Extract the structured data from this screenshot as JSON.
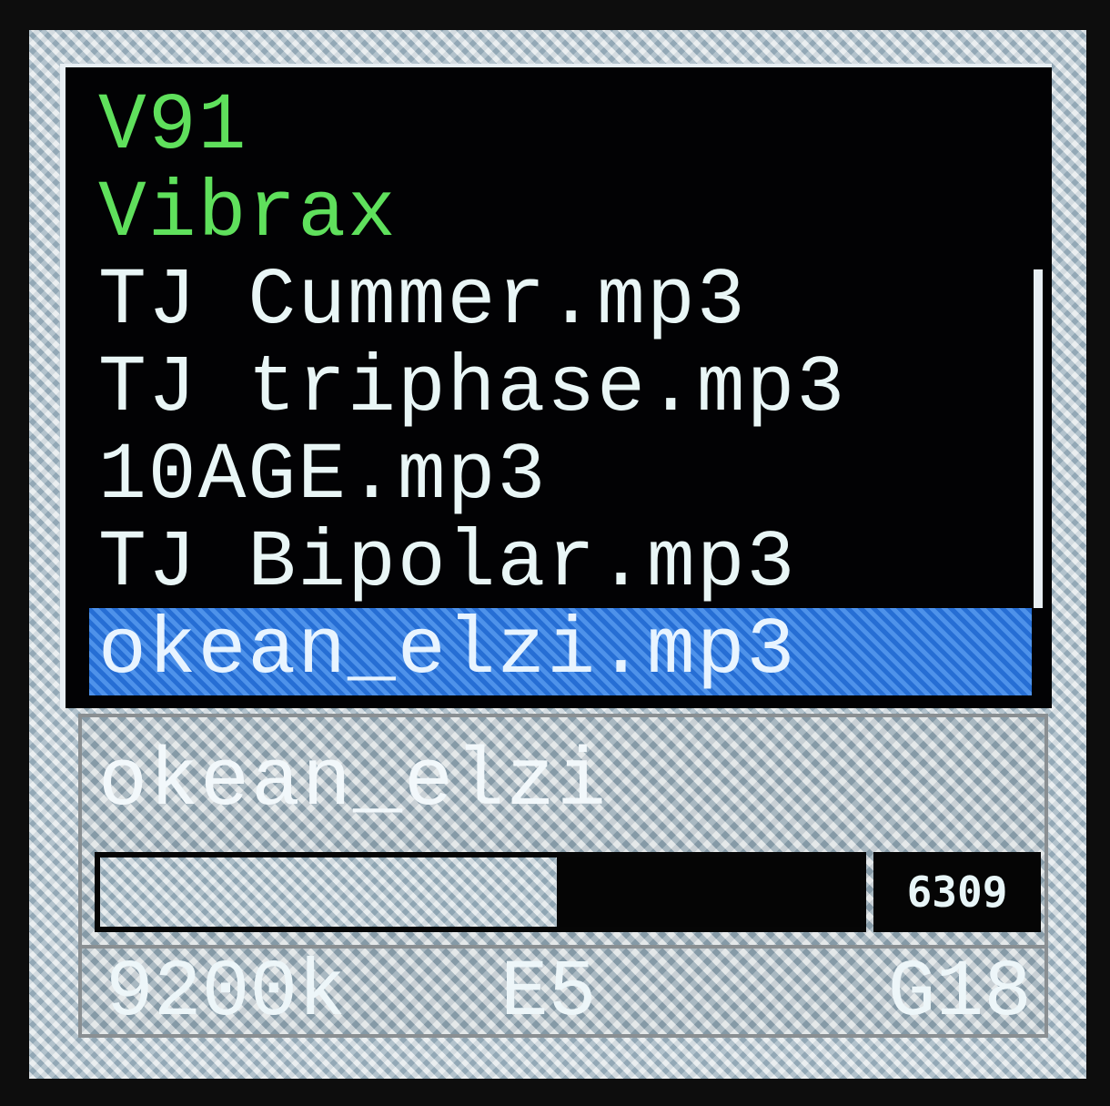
{
  "file_list": {
    "items": [
      {
        "label": "V91",
        "type": "folder"
      },
      {
        "label": "Vibrax",
        "type": "folder"
      },
      {
        "label": "TJ Cummer.mp3",
        "type": "file"
      },
      {
        "label": "TJ triphase.mp3",
        "type": "file"
      },
      {
        "label": "10AGE.mp3",
        "type": "file"
      },
      {
        "label": "TJ Bipolar.mp3",
        "type": "file"
      },
      {
        "label": "okean_elzi.mp3",
        "type": "file",
        "selected": true
      }
    ]
  },
  "now_playing": {
    "title": "okean_elzi",
    "progress_fraction": 0.6,
    "counter": "6309"
  },
  "status": {
    "bitrate": "9200k",
    "eq": "E5",
    "gain": "G18"
  },
  "colors": {
    "folder_text": "#5fe05c",
    "file_text": "#e9f6f6",
    "selection": "#2f7fe6",
    "screen_bg": "#020204"
  }
}
